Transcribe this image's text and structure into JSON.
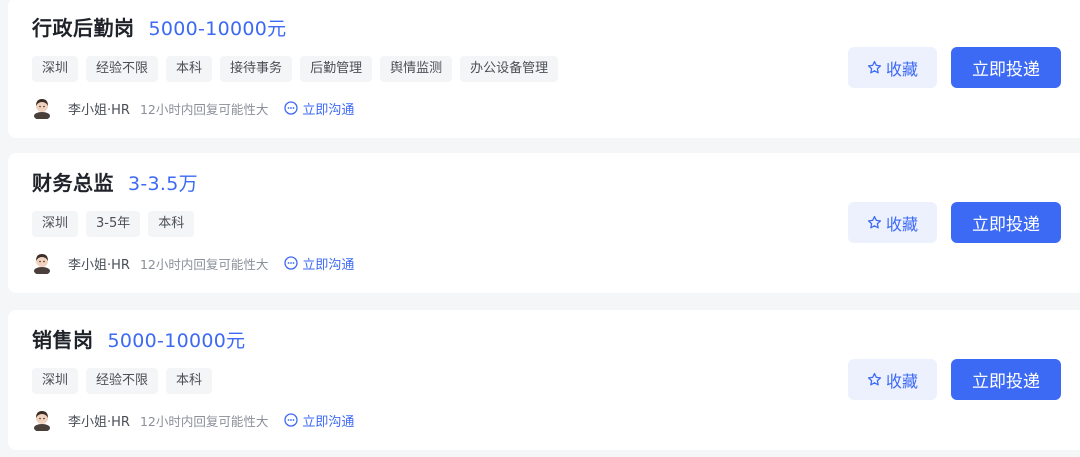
{
  "colors": {
    "accent": "#3d6af5",
    "collect_bg": "#edf1fe",
    "tag_bg": "#f4f5f7",
    "page_bg": "#f5f6f8"
  },
  "jobs": [
    {
      "title": "行政后勤岗",
      "salary": "5000-10000元",
      "tags": [
        "深圳",
        "经验不限",
        "本科",
        "接待事务",
        "后勤管理",
        "舆情监测",
        "办公设备管理"
      ],
      "hr_name": "李小姐·HR",
      "reply_hint": "12小时内回复可能性大",
      "chat_label": "立即沟通",
      "collect_label": "收藏",
      "apply_label": "立即投递"
    },
    {
      "title": "财务总监",
      "salary": "3-3.5万",
      "tags": [
        "深圳",
        "3-5年",
        "本科"
      ],
      "hr_name": "李小姐·HR",
      "reply_hint": "12小时内回复可能性大",
      "chat_label": "立即沟通",
      "collect_label": "收藏",
      "apply_label": "立即投递"
    },
    {
      "title": "销售岗",
      "salary": "5000-10000元",
      "tags": [
        "深圳",
        "经验不限",
        "本科"
      ],
      "hr_name": "李小姐·HR",
      "reply_hint": "12小时内回复可能性大",
      "chat_label": "立即沟通",
      "collect_label": "收藏",
      "apply_label": "立即投递"
    }
  ]
}
